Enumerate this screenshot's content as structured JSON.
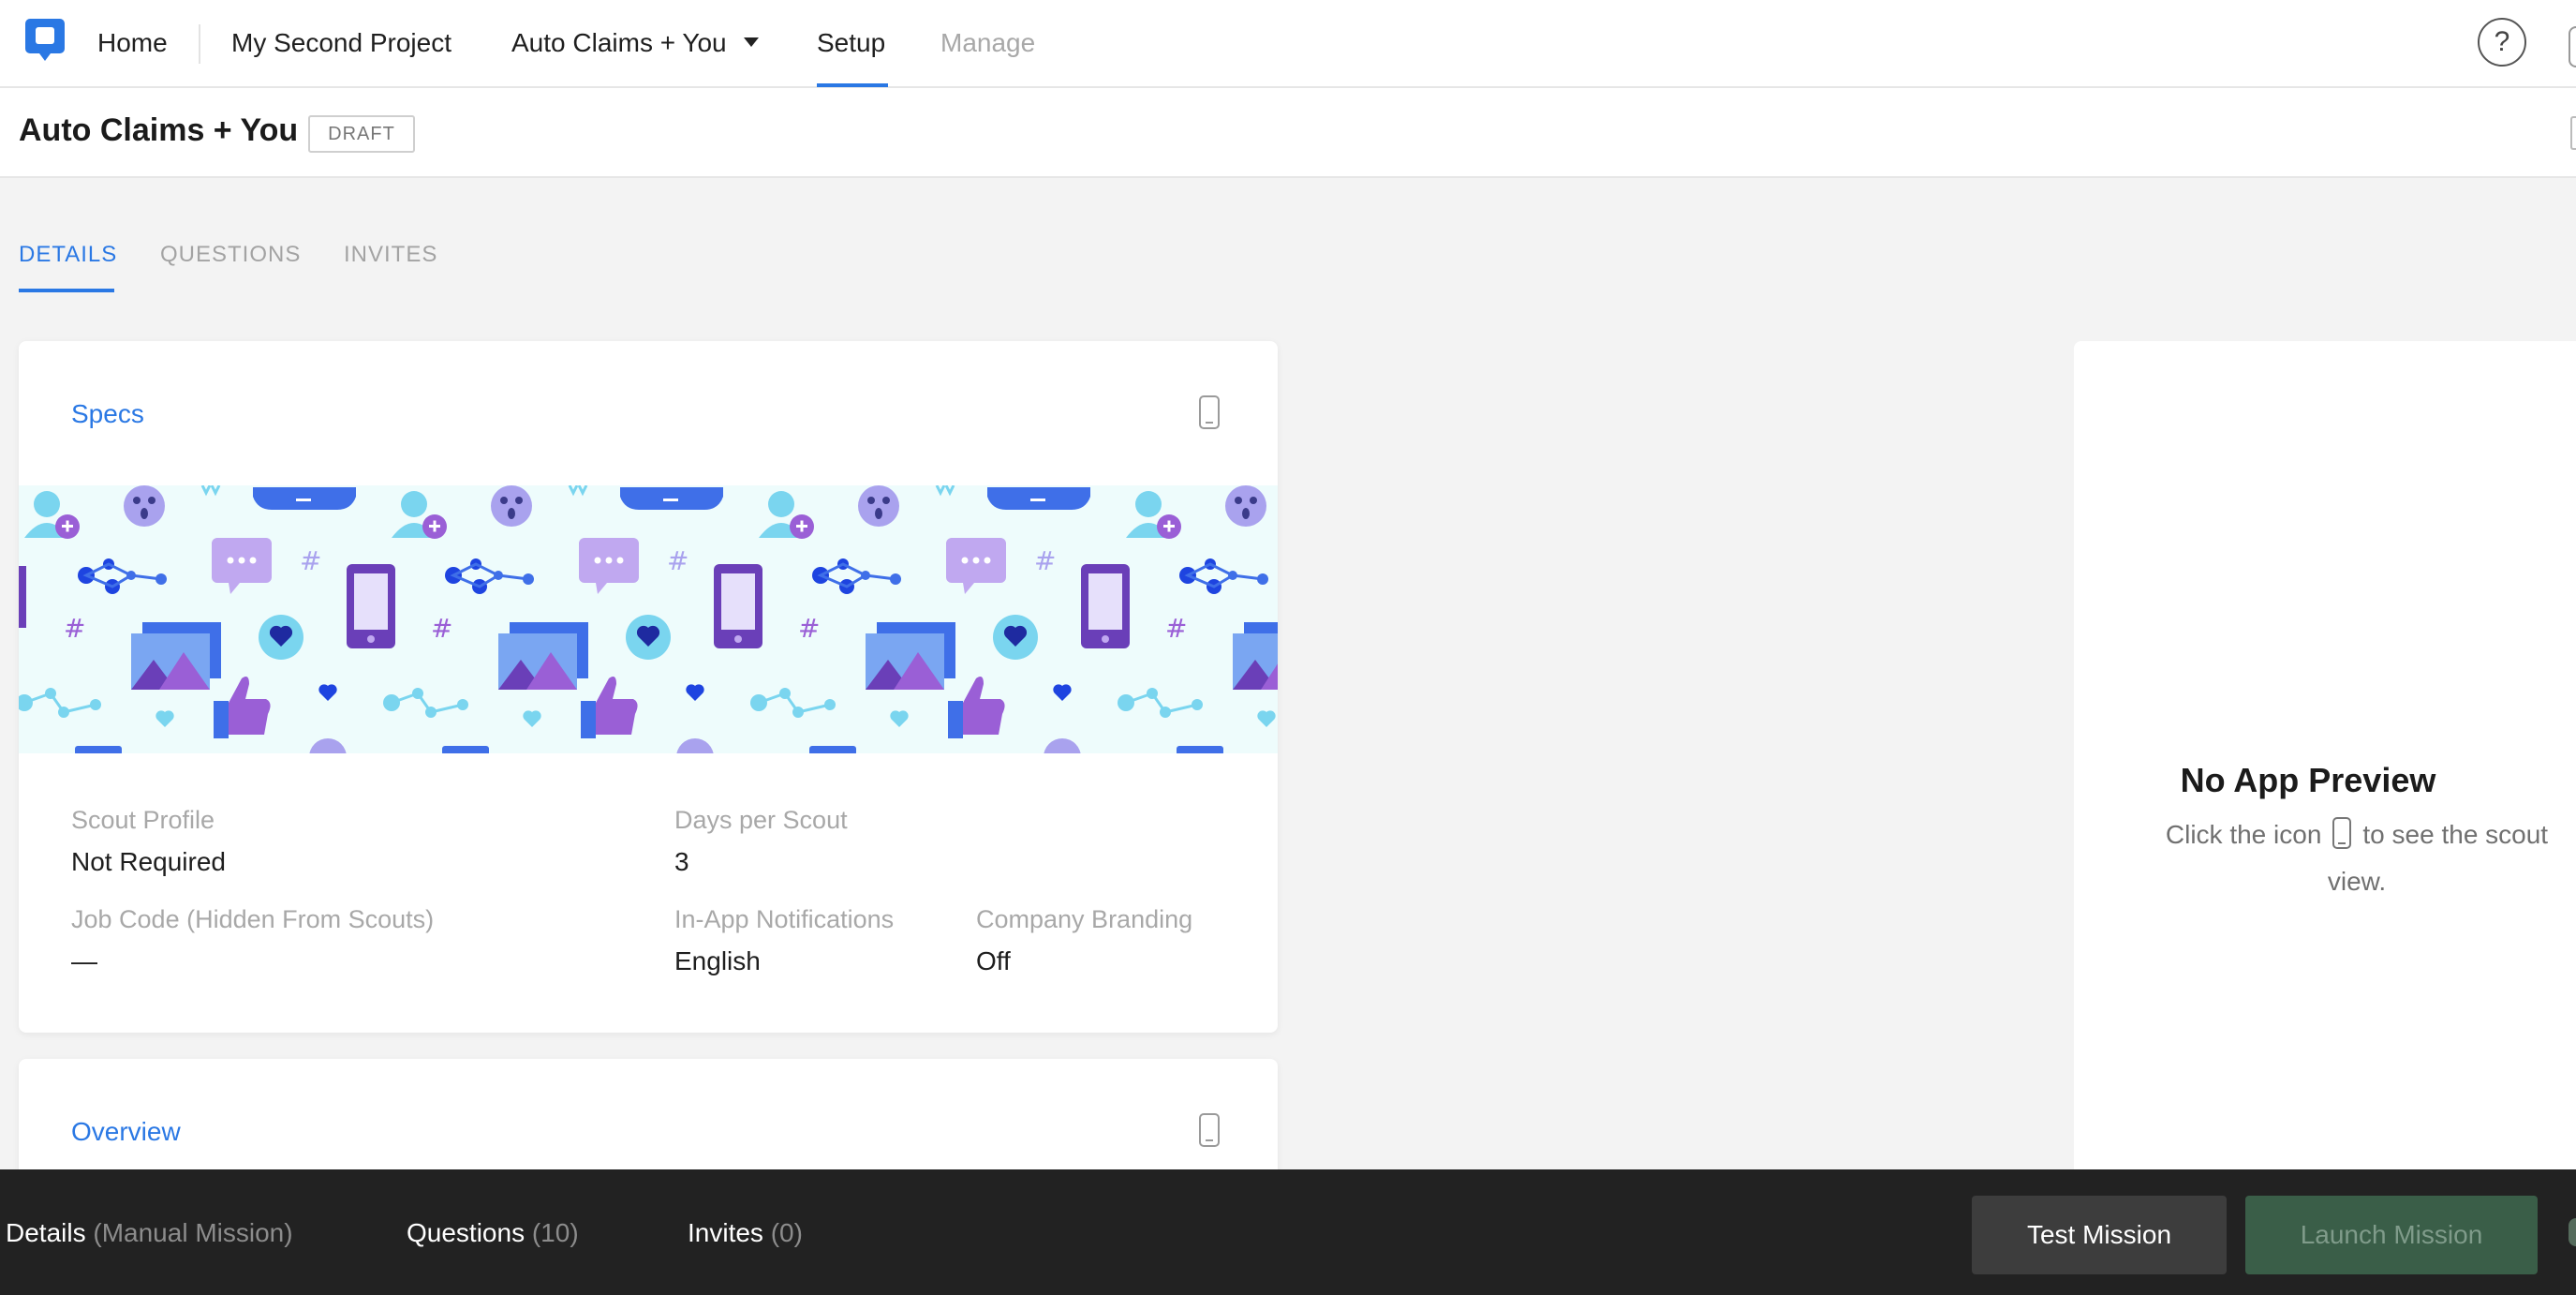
{
  "nav": {
    "home": "Home",
    "project": "My Second Project",
    "mission_menu": "Auto Claims + You",
    "setup": "Setup",
    "manage": "Manage",
    "help": "?"
  },
  "header": {
    "title": "Auto Claims + You",
    "status": "DRAFT"
  },
  "tabs": [
    {
      "label": "DETAILS",
      "active": true
    },
    {
      "label": "QUESTIONS",
      "active": false
    },
    {
      "label": "INVITES",
      "active": false
    }
  ],
  "specs": {
    "title": "Specs",
    "scout_profile_label": "Scout Profile",
    "scout_profile_value": "Not Required",
    "days_label": "Days per Scout",
    "days_value": "3",
    "job_code_label": "Job Code (Hidden From Scouts)",
    "job_code_value": "—",
    "notifications_label": "In-App Notifications",
    "notifications_value": "English",
    "branding_label": "Company Branding",
    "branding_value": "Off"
  },
  "overview": {
    "title": "Overview"
  },
  "preview": {
    "title": "No App Preview",
    "desc_before": "Click the icon",
    "desc_after": "to see the scout view."
  },
  "bottom_bar": {
    "details_label": "Details",
    "details_type": "(Manual Mission)",
    "questions_label": "Questions",
    "questions_count": "(10)",
    "invites_label": "Invites",
    "invites_count": "(0)",
    "test_button": "Test Mission",
    "launch_button": "Launch Mission"
  },
  "colors": {
    "accent": "#2a78e4",
    "bottom_bar": "#222222",
    "launch_button": "#3a5e48"
  }
}
